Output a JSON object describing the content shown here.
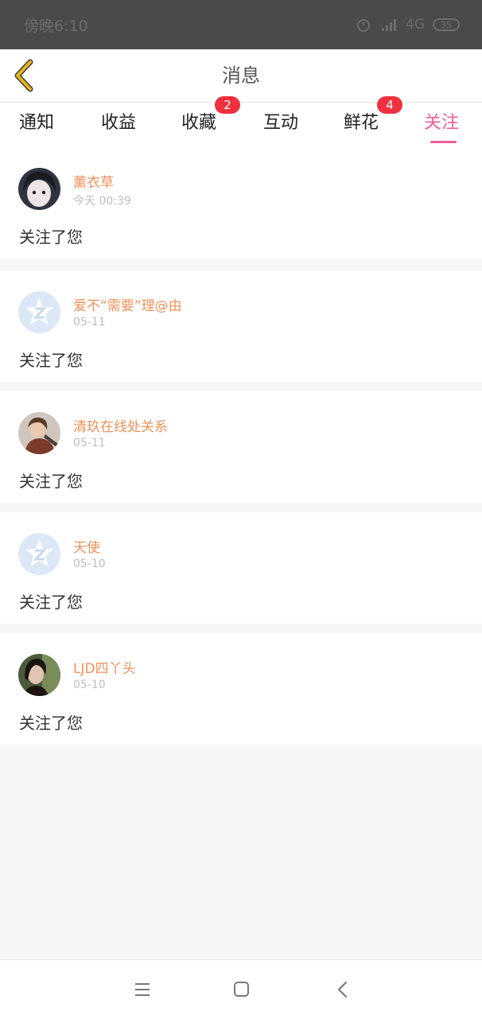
{
  "status_bar": {
    "time": "傍晚6:10",
    "network": "4G",
    "battery": "35",
    "icons": [
      "alarm-icon",
      "signal-icon",
      "battery-icon"
    ]
  },
  "header": {
    "title": "消息",
    "back_icon": "chevron-left-icon"
  },
  "tabs": [
    {
      "label": "通知",
      "badge": ""
    },
    {
      "label": "收益",
      "badge": ""
    },
    {
      "label": "收藏",
      "badge": "2"
    },
    {
      "label": "互动",
      "badge": ""
    },
    {
      "label": "鲜花",
      "badge": "4"
    },
    {
      "label": "关注",
      "badge": "",
      "active": true
    }
  ],
  "messages": [
    {
      "name": "薰衣草",
      "time": "今天 00:39",
      "text": "关注了您",
      "avatar": "photo-avatar"
    },
    {
      "name": "爱不“需要”理@由",
      "time": "05-11",
      "text": "关注了您",
      "avatar": "default-qq-avatar"
    },
    {
      "name": "清玖在线处关系",
      "time": "05-11",
      "text": "关注了您",
      "avatar": "photo-avatar"
    },
    {
      "name": "天使",
      "time": "05-10",
      "text": "关注了您",
      "avatar": "default-qq-avatar"
    },
    {
      "name": "LJD四丫头",
      "time": "05-10",
      "text": "关注了您",
      "avatar": "photo-avatar"
    }
  ],
  "colors": {
    "accent": "#ee5e9d",
    "username": "#f0905a",
    "badge": "#f0303e",
    "back_arrow": "#e3b51f"
  },
  "nav_bar": {
    "icons": [
      "menu-icon",
      "home-square-icon",
      "back-triangle-icon"
    ]
  }
}
